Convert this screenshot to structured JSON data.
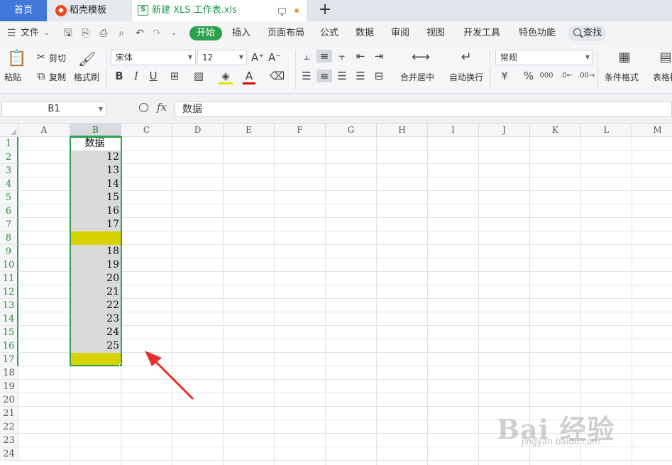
{
  "tabs": {
    "home": "首页",
    "template": "稻壳模板",
    "document": "新建 XLS 工作表.xls"
  },
  "menu": {
    "file": "文件",
    "items": [
      "开始",
      "插入",
      "页面布局",
      "公式",
      "数据",
      "审阅",
      "视图",
      "开发工具",
      "特色功能"
    ],
    "search": "查找"
  },
  "ribbon": {
    "paste": "粘贴",
    "cut": "剪切",
    "copy": "复制",
    "format_painter": "格式刷",
    "font_name": "宋体",
    "font_size": "12",
    "merge_center": "合并居中",
    "wrap_text": "自动换行",
    "number_format": "常规",
    "conditional_format": "条件格式",
    "table_style": "表格样"
  },
  "formula_bar": {
    "cell_ref": "B1",
    "fx": "fx",
    "content": "数据"
  },
  "sheet": {
    "columns": [
      "A",
      "B",
      "C",
      "D",
      "E",
      "F",
      "G",
      "H",
      "I",
      "J",
      "K",
      "L",
      "M"
    ],
    "rows": [
      "1",
      "2",
      "3",
      "4",
      "5",
      "6",
      "7",
      "8",
      "9",
      "10",
      "11",
      "12",
      "13",
      "14",
      "15",
      "16",
      "17",
      "18",
      "19",
      "20",
      "21",
      "22",
      "23",
      "24"
    ],
    "column_b": [
      "数据",
      "12",
      "13",
      "14",
      "15",
      "16",
      "17",
      "",
      "18",
      "19",
      "20",
      "21",
      "22",
      "23",
      "24",
      "25",
      ""
    ],
    "highlight_color": "#d6d300",
    "selection_color": "#2aa14a"
  },
  "watermark": {
    "brand": "Bai 经验",
    "url": "jingyan.baidu.com"
  }
}
